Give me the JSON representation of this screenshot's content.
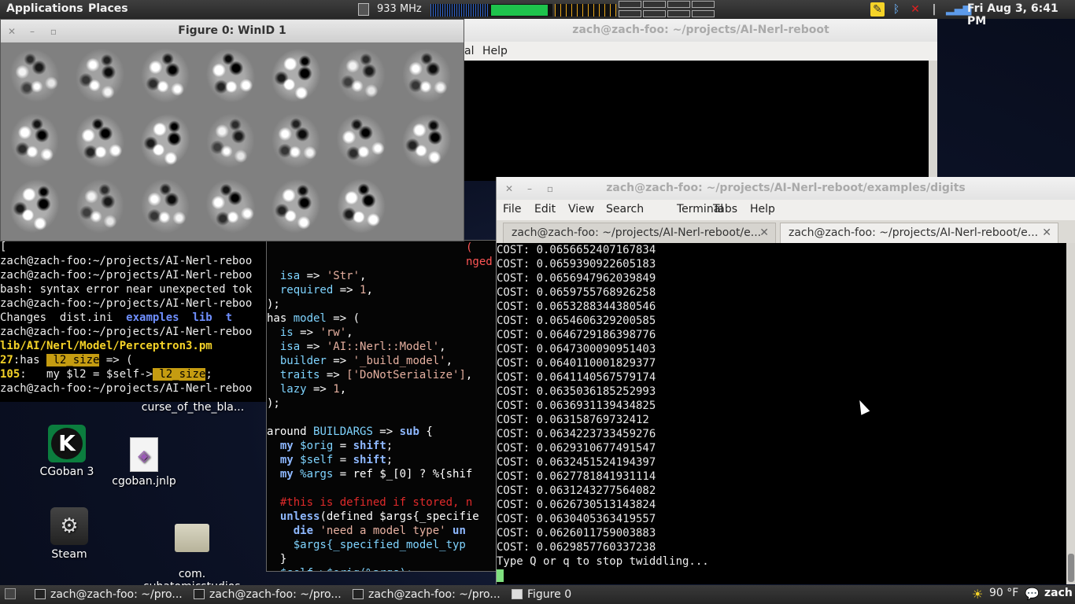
{
  "top_panel": {
    "applications": "Applications",
    "places": "Places",
    "cpu_freq": "933 MHz",
    "memory_fraction": 0.95,
    "clock": "Fri Aug  3,  6:41 PM"
  },
  "back_terminal": {
    "title": "zach@zach-foo: ~/projects/AI-Nerl-reboot",
    "menu_partial": "al",
    "menu_help": "Help"
  },
  "figure": {
    "title": "Figure 0:  WinID 1",
    "patches_rows": 3,
    "patches_cols": 7
  },
  "left_terminal": {
    "lines": [
      "zach@zach-foo:~/projects/AI-Nerl-reboo",
      "zach@zach-foo:~/projects/AI-Nerl-reboo",
      "bash: syntax error near unexpected tok",
      "zach@zach-foo:~/projects/AI-Nerl-reboo",
      "zach@zach-foo:~/projects/AI-Nerl-reboo",
      "zach@zach-foo:~/projects/AI-Nerl-reboo"
    ],
    "ls_files": "Changes  dist.ini  ",
    "ls_dirs": "examples  lib  t",
    "perceptron_path": "lib/AI/Nerl/Model/Perceptron3.pm",
    "line27_num": "27",
    "line27_text": ":has ",
    "line27_hl": " l2_size",
    "line27_rest": " => (",
    "line105_num": "105",
    "line105_text": ":   my $l2 = $self->",
    "line105_hl": " l2_size",
    "line105_rest": ";",
    "last_line": "zach@zach-foo:~/projects/AI-Nerl-reboo"
  },
  "mid_terminal": {
    "lines": [
      {
        "pre": "  ",
        "a": "isa",
        "b": " => ",
        "c": "'Str'",
        "d": ","
      },
      {
        "pre": "  ",
        "a": "required",
        "b": " => ",
        "c": "1",
        "d": ","
      },
      {
        "pre": "",
        "a": ");",
        "b": "",
        "c": "",
        "d": ""
      },
      {
        "pre": "",
        "a": "has ",
        "b": "model",
        "c": " => (",
        "d": ""
      },
      {
        "pre": "  ",
        "a": "is",
        "b": " => ",
        "c": "'rw'",
        "d": ","
      },
      {
        "pre": "  ",
        "a": "isa",
        "b": " => ",
        "c": "'AI::Nerl::Model'",
        "d": ","
      },
      {
        "pre": "  ",
        "a": "builder",
        "b": " => ",
        "c": "'_build_model'",
        "d": ","
      },
      {
        "pre": "  ",
        "a": "traits",
        "b": " => ",
        "c": "['DoNotSerialize']",
        "d": ","
      },
      {
        "pre": "  ",
        "a": "lazy",
        "b": " => ",
        "c": "1",
        "d": ","
      },
      {
        "pre": "",
        "a": ");",
        "b": "",
        "c": "",
        "d": ""
      }
    ],
    "around": "around ",
    "buildargs": "BUILDARGS",
    "arrow_sub": " => ",
    "sub": "sub",
    "brace": " {",
    "my1": "my ",
    "orig": "$orig",
    "eq_shift1": " = ",
    "shift1": "shift",
    "my2": "my ",
    "self": "$self",
    "shift2": "shift",
    "my3": "my ",
    "args": "%args",
    "ref_line": " = ref $_[0] ? %{shif",
    "comment": "#this is defined if stored, n",
    "unless": "unless",
    "unless_rest": "(defined $args{_specifie",
    "die": "die",
    "die_str": " 'need a model type' ",
    "die_un": "un",
    "args_line": "$args{_specified_model_typ",
    "close_brace": "}",
    "self_orig": "$self->$orig(%args);",
    "red_paren": "(",
    "red_nged": "nged"
  },
  "front_terminal": {
    "title": "zach@zach-foo: ~/projects/AI-Nerl-reboot/examples/digits",
    "menus": [
      "File",
      "Edit",
      "View",
      "Search",
      "Terminal",
      "Tabs",
      "Help"
    ],
    "tabs": [
      {
        "label": "zach@zach-foo: ~/projects/AI-Nerl-reboot/e..."
      },
      {
        "label": "zach@zach-foo: ~/projects/AI-Nerl-reboot/e..."
      }
    ],
    "cost_lines": [
      "COST: 0.0656652407167834",
      "COST: 0.0659390922605183",
      "COST: 0.0656947962039849",
      "COST: 0.0659755768926258",
      "COST: 0.0653288344380546",
      "COST: 0.0654606329200585",
      "COST: 0.0646729186398776",
      "COST: 0.0647300090951403",
      "COST: 0.0640110001829377",
      "COST: 0.0641140567579174",
      "COST: 0.0635036185252993",
      "COST: 0.0636931139434825",
      "COST: 0.063158769732412",
      "COST: 0.0634223733459276",
      "COST: 0.0629310677491547",
      "COST: 0.0632451524194397",
      "COST: 0.0627781841931114",
      "COST: 0.0631243277564082",
      "COST: 0.0626730513143824",
      "COST: 0.0630405363419557",
      "COST: 0.0626011759003883",
      "COST: 0.0629857760337238"
    ],
    "prompt": "Type Q or q to stop twiddling..."
  },
  "desktop": {
    "curse_label": "curse_of_the_bla...",
    "cgoban_label": "CGoban 3",
    "cgoban_jnlp_label": "cgoban.jnlp",
    "steam_label": "Steam",
    "subatomic_label": "com.\nsubatomicstudios"
  },
  "bottom_panel": {
    "tasks": [
      "zach@zach-foo: ~/pro...",
      "zach@zach-foo: ~/pro...",
      "zach@zach-foo: ~/pro...",
      "Figure 0"
    ],
    "weather": "90 °F",
    "user": "zach"
  },
  "colors": {
    "prompt_green": "#7fe07f",
    "path_yellow": "#f5d328",
    "dir_blue": "#6f8fff"
  }
}
